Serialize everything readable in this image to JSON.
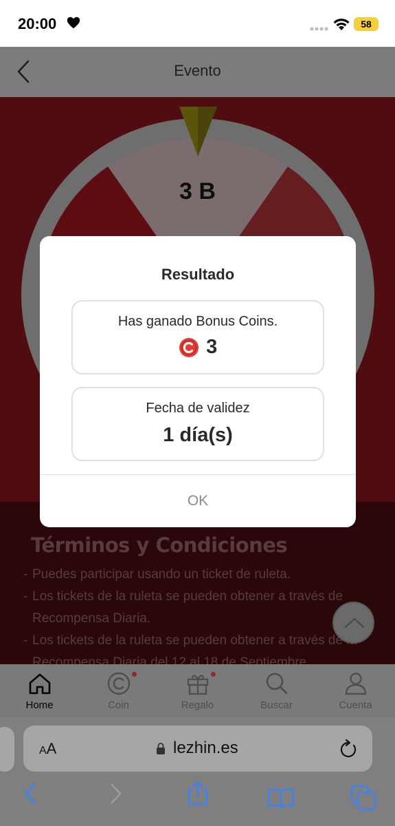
{
  "status_bar": {
    "time": "20:00",
    "battery": "58"
  },
  "app_bar": {
    "title": "Evento"
  },
  "wheel": {
    "current_segment": "3 B"
  },
  "terms": {
    "title": "Términos y Condiciones",
    "items": [
      "Puedes participar usando un ticket de ruleta.",
      "Los tickets de la ruleta se pueden obtener a través de Recompensa Diaria.",
      "Los tickets de la ruleta se pueden obtener a través de la Recompensa Diaria del 12 al 18 de Septiembre"
    ]
  },
  "modal": {
    "title": "Resultado",
    "prize_caption": "Has ganado Bonus Coins.",
    "prize_value": "3",
    "validity_caption": "Fecha de validez",
    "validity_value": "1 día(s)",
    "ok_label": "OK"
  },
  "tab_bar": {
    "items": [
      {
        "label": "Home",
        "icon": "home-icon",
        "active": true
      },
      {
        "label": "Coin",
        "icon": "coin-icon",
        "badge": true
      },
      {
        "label": "Regalo",
        "icon": "gift-icon",
        "badge": true
      },
      {
        "label": "Buscar",
        "icon": "search-icon"
      },
      {
        "label": "Cuenta",
        "icon": "account-icon"
      }
    ]
  },
  "browser": {
    "text_size_label": "AA",
    "url": "lezhin.es"
  },
  "colors": {
    "overlay_header": "#7c7c7c",
    "event_background": "#4f0d12",
    "coin_red": "#e23b32",
    "browser_blue": "#3b82f6"
  }
}
